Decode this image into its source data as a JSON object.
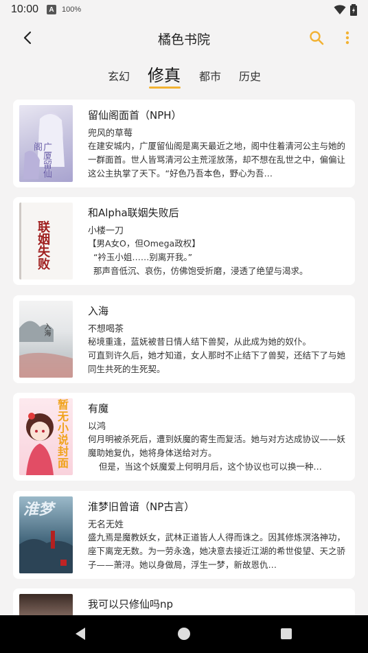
{
  "status": {
    "time": "10:00",
    "a_icon": "A",
    "battery_pct": "100%"
  },
  "app_bar": {
    "title": "橘色书院"
  },
  "tabs": [
    {
      "label": "玄幻",
      "active": false
    },
    {
      "label": "修真",
      "active": true
    },
    {
      "label": "都市",
      "active": false
    },
    {
      "label": "历史",
      "active": false
    }
  ],
  "colors": {
    "accent": "#f2b233",
    "background": "#f4f3f3",
    "card": "#ffffff"
  },
  "books": [
    {
      "title": "留仙阁面首（NPH）",
      "author": "兜风的草莓",
      "desc": "在建安城内，广厦留仙阁是离天最近之地，阁中住着清河公主与她的一群面首。世人皆骂清河公主荒淫放荡，却不想在乱世之中，偏偏让这公主执掌了天下。“好色乃吾本色，野心为吾…",
      "cover_text": "广厦留仙阁"
    },
    {
      "title": "和Alpha联姻失败后",
      "author": "小楼一刀",
      "desc": "【男A女O，但Omega政权】\n  “衿玉小姐……别离开我。”\n  那声音低沉、哀伤，仿佛饱受折磨，浸透了绝望与渴求。",
      "cover_text": "联姻失败"
    },
    {
      "title": "入海",
      "author": "不想喝茶",
      "desc": "秘境重逢，蓝妩被昔日情人结下兽契，从此成为她的奴仆。\n可直到许久后，她才知道，女人那时不止结下了兽契，还结下了与她同生共死的生死契。",
      "cover_text": "入海"
    },
    {
      "title": "有魔",
      "author": "以鸿",
      "desc": "何月明被杀死后，遭到妖魔的寄生而复活。她与对方达成协议——妖魔助她复仇，她将身体送给对方。\n    但是，当这个妖魔爱上何明月后，这个协议也可以换一种…",
      "cover_text": "暂无小说封面"
    },
    {
      "title": "淮梦旧曾谙（NP古言）",
      "author": "无名无姓",
      "desc": "盛九焉是魔教妖女，武林正道皆人人得而诛之。因其修炼溟洛神功，座下离宠无数。为一劳永逸，她决意去接近江湖的希世俊望、天之骄子——萧浔。她以身做局，浮生一梦，新故恩仇…",
      "cover_text": "淮梦"
    },
    {
      "title": "我可以只修仙吗np",
      "author": "",
      "desc": "",
      "cover_text": ""
    }
  ]
}
